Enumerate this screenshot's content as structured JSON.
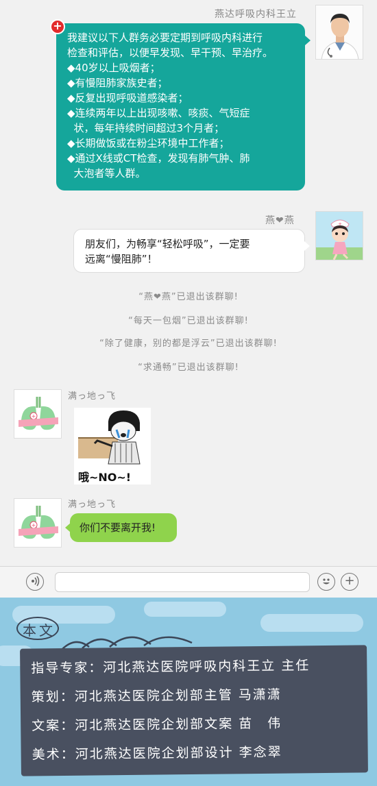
{
  "messages": {
    "doctor": {
      "sender": "燕达呼吸内科王立",
      "lines": [
        "我建议以下人群务必要定期到呼吸内科进行",
        "检查和评估，以便早发现、早干预、早治疗。",
        "◆40岁以上吸烟者；",
        "◆有慢阻肺家族史者；",
        "◆反复出现呼吸道感染者；",
        "◆连续两年以上出现咳嗽、咳痰、气短症",
        "  状，每年持续时间超过3个月者；",
        "◆长期做饭或在粉尘环境中工作者；",
        "◆通过X线或CT检查，发现有肺气肿、肺",
        "  大泡者等人群。"
      ]
    },
    "nurse": {
      "sender": "燕❤燕",
      "lines": [
        "朋友们，为畅享“轻松呼吸”，一定要",
        "远离“慢阻肺”！"
      ]
    },
    "system": [
      "“燕❤燕”已退出该群聊!",
      "“每天一包烟”已退出该群聊!",
      "“除了健康，别的都是浮云”已退出该群聊!",
      "“求通畅”已退出该群聊!"
    ],
    "lung1": {
      "sender": "满っ地っ飞",
      "sticker_caption": "哦~NO~!"
    },
    "lung2": {
      "sender": "满っ地っ飞",
      "text": "你们不要离开我!"
    }
  },
  "footer": {
    "heading": "本文",
    "credits": [
      "指导专家：河北燕达医院呼吸内科王立 主任",
      "策划：河北燕达医院企划部主管 马潇潇",
      "文案：河北燕达医院企划部文案 苗　伟",
      "美术：河北燕达医院企划部设计 李念翠"
    ]
  },
  "icons": {
    "voice": "voice-icon",
    "emoji": "emoji-icon",
    "add": "add-icon",
    "plus_badge": "plus-badge-icon"
  },
  "colors": {
    "teal": "#15a69b",
    "green": "#8fd34c",
    "footer_bg": "#8fc9e2",
    "board": "#495060"
  }
}
